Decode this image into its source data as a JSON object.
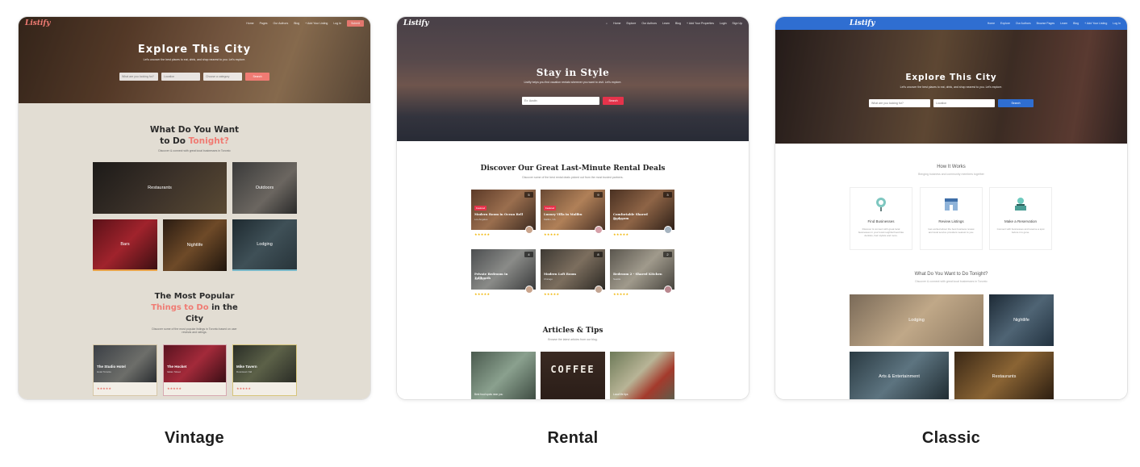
{
  "cards": [
    {
      "label": "Vintage",
      "logo": "Listify",
      "menu": [
        "Home",
        "Pages",
        "Our Authors",
        "Blog",
        "+ Add Your Listing",
        "Log In"
      ],
      "cta": "Submit",
      "hero_title": "Explore This City",
      "hero_sub": "Let's uncover the best places to eat, drink, and shop nearest to you. Let's explore.",
      "search_fields": [
        "What are you looking for?",
        "Location",
        "Choose a category"
      ],
      "search_button": "Search",
      "section1_title_a": "What Do You Want",
      "section1_title_b": "to Do ",
      "section1_title_accent": "Tonight?",
      "section1_sub": "Discover & connect with great local businesses in Toronto",
      "tiles": [
        "Restaurants",
        "Outdoors",
        "Bars",
        "Nightlife",
        "Lodging"
      ],
      "section2_title_a": "The Most Popular",
      "section2_title_accent": "Things to Do",
      "section2_title_b": " in the",
      "section2_title_c": "City",
      "section2_sub": "Discover some of the most popular listings in Toronto based on user reviews and ratings.",
      "listings": [
        {
          "title": "The Studio Hotel",
          "meta": "Hotel Toronto"
        },
        {
          "title": "The Hocket",
          "meta": "Italian Street"
        },
        {
          "title": "Mike Tavern",
          "meta": "Downtown Kid"
        }
      ],
      "colors": {
        "accent": "#f07b73",
        "bg": "#e2ddd3"
      }
    },
    {
      "label": "Rental",
      "logo": "Listify",
      "menu": [
        "Home",
        "Explore",
        "Our Authors",
        "Learn",
        "Blog",
        "+ Add Your Properties",
        "Login",
        "Sign Up"
      ],
      "hero_title": "Stay in Style",
      "hero_sub": "Listify helps you find vacation rentals wherever you want to visit. Let's explore.",
      "search_fields": [
        "Ex: Austin"
      ],
      "search_button": "Search",
      "section1_title": "Discover Our Great Last-Minute Rental Deals",
      "section1_sub": "Discover some of the best rental deals picked out from the most trusted partners.",
      "rentals": [
        {
          "title": "Modern Room in Ocean Bell",
          "meta": "Los Angeles",
          "tag": "Featured",
          "count": "5"
        },
        {
          "title": "Luxury Villa in Malibu",
          "meta": "Malibu, CA",
          "tag": "Featured",
          "count": "9"
        },
        {
          "title": "Comfortable Shared Bedroom",
          "meta": "New York",
          "tag": "",
          "count": "3"
        },
        {
          "title": "Private Bedroom in Tollbooth",
          "meta": "San Diego",
          "tag": "",
          "count": "4"
        },
        {
          "title": "Modern Loft Room",
          "meta": "Chicago",
          "tag": "",
          "count": "8"
        },
        {
          "title": "Bedroom 2 - Shared Kitchen",
          "meta": "Seattle",
          "tag": "",
          "count": "2"
        }
      ],
      "stars": "★★★★★",
      "section2_title": "Articles & Tips",
      "section2_sub": "Browse the latest articles from our blog.",
      "articles": [
        "Best food spots near you",
        "COFFEE",
        "Local life tips"
      ],
      "colors": {
        "accent": "#e5334b"
      }
    },
    {
      "label": "Classic",
      "logo": "Listify",
      "menu": [
        "Home",
        "Explore",
        "Our Authors",
        "Browse Pages",
        "Learn",
        "Blog",
        "+ Add Your Listing",
        "Log In"
      ],
      "hero_title": "Explore This City",
      "hero_sub": "Let's uncover the best places to eat, drink, and shop nearest to you. Let's explore.",
      "search_fields": [
        "What are you looking for?",
        "Location"
      ],
      "search_button": "Search",
      "how_title": "How It Works",
      "how_sub": "Bringing business and community members together",
      "how": [
        {
          "title": "Find Businesses",
          "text": "Discover & connect with great local businesses in your local neighborhood like dentists, hair stylists and more."
        },
        {
          "title": "Review Listings",
          "text": "Get excited about the best business review and local service providers nearest to you."
        },
        {
          "title": "Make a Reservation",
          "text": "Connect with businesses and reserve a spot before it is gone."
        }
      ],
      "section_title": "What Do You Want to Do Tonight?",
      "section_sub": "Discover & connect with great local businesses in Toronto",
      "tiles": [
        "Lodging",
        "Nightlife",
        "Arts & Entertainment",
        "Restaurants"
      ],
      "colors": {
        "topbar": "#2f6ed1"
      }
    }
  ]
}
